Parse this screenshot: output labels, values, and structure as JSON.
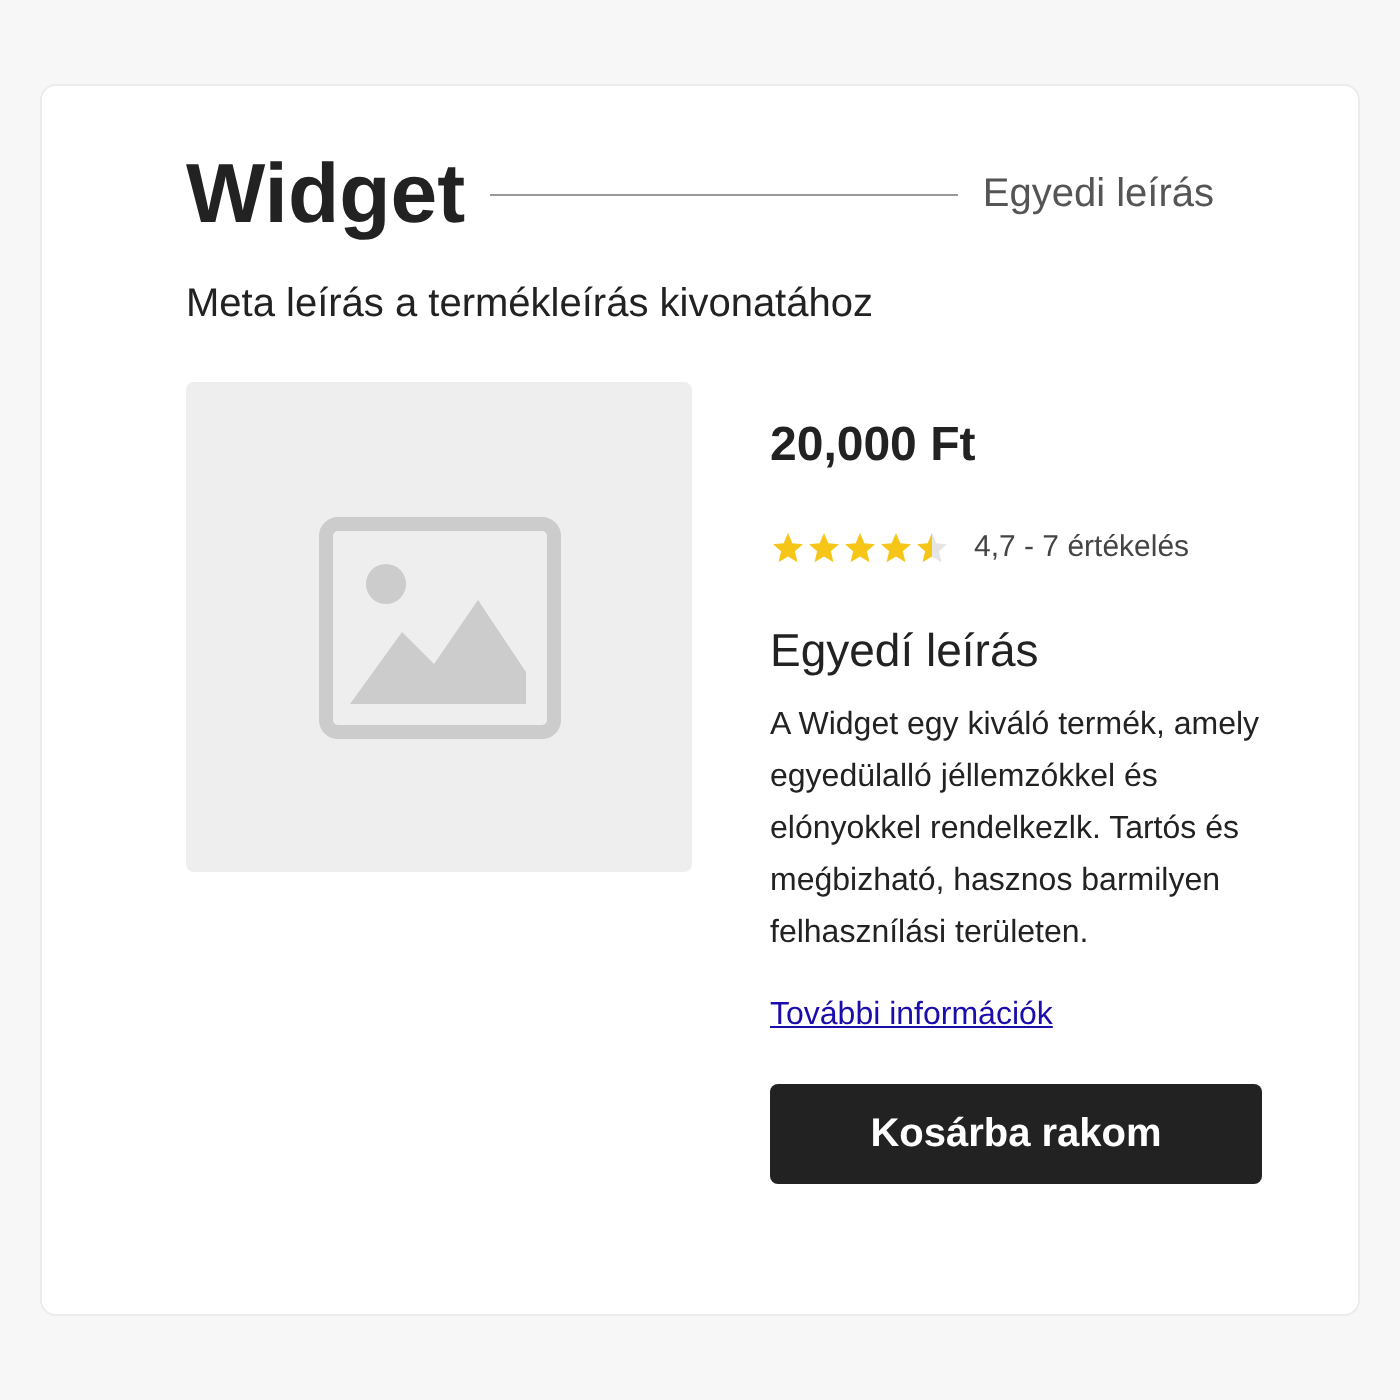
{
  "title": "Widget",
  "tagline": "Egyedi leírás",
  "meta_description": "Meta leírás a termékleírás kivonatához",
  "image": {
    "kind": "placeholder"
  },
  "price": "20,000 Ft",
  "rating": {
    "stars": 4.5,
    "text": "4,7 - 7 értékelés"
  },
  "description_heading": "Egyedí leírás",
  "description": "A Widget egy kiváló termék, amely egyedülalló jéllemzókkel és elónyokkel rendelkezlk. Tartós és meǵbizható, hasznos barmilyen felhasznílási területen.",
  "more_link": "További információk",
  "cart_button": "Kosárba rakom"
}
